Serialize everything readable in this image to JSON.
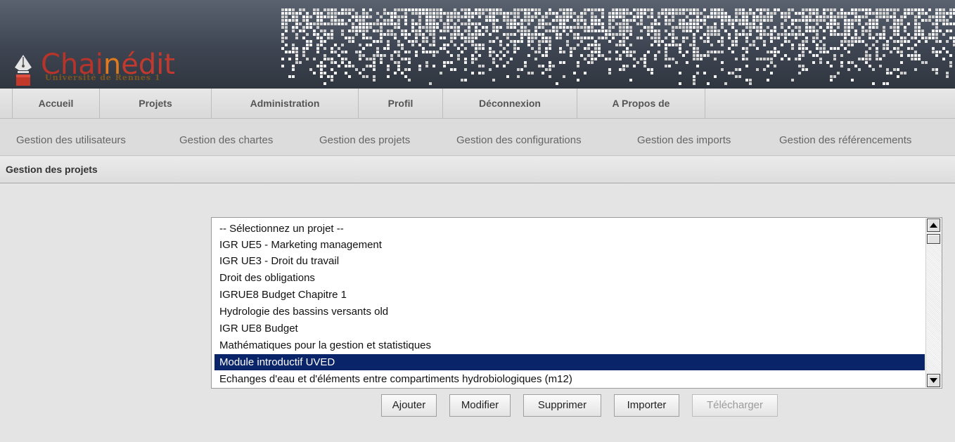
{
  "header": {
    "logo_icon": "fountain-pen-icon",
    "title_prefix": "Chai",
    "title_accent": "n",
    "title_rest": "édit",
    "subtitle": "Université de Rennes 1"
  },
  "main_nav": {
    "tabs": [
      {
        "label": "Accueil"
      },
      {
        "label": "Projets"
      },
      {
        "label": "Administration"
      },
      {
        "label": "Profil"
      },
      {
        "label": "Déconnexion"
      },
      {
        "label": "A Propos de"
      }
    ]
  },
  "sub_nav": {
    "items": [
      {
        "label": "Gestion des utilisateurs"
      },
      {
        "label": "Gestion des chartes"
      },
      {
        "label": "Gestion des projets"
      },
      {
        "label": "Gestion des configurations"
      },
      {
        "label": "Gestion des imports"
      },
      {
        "label": "Gestion des référencements"
      }
    ]
  },
  "section": {
    "title": "Gestion des projets"
  },
  "project_list": {
    "options": [
      "-- Sélectionnez un projet --",
      "IGR UE5 - Marketing management",
      "IGR UE3 - Droit du travail",
      "Droit des obligations",
      "IGRUE8 Budget Chapitre 1",
      "Hydrologie des bassins versants old",
      "IGR UE8 Budget",
      "Mathématiques pour la gestion et statistiques",
      "Module introductif UVED",
      "Echanges d'eau et d'éléments entre compartiments hydrobiologiques (m12)"
    ],
    "selected": "Module introductif UVED",
    "scroll_up_icon": "arrow-up-icon",
    "scroll_down_icon": "arrow-down-icon"
  },
  "buttons": {
    "add": "Ajouter",
    "edit": "Modifier",
    "delete": "Supprimer",
    "import": "Importer",
    "download": "Télécharger"
  },
  "colors": {
    "selection": "#0a246a",
    "brand_red": "#b8342a",
    "brand_orange": "#e07a1e"
  }
}
